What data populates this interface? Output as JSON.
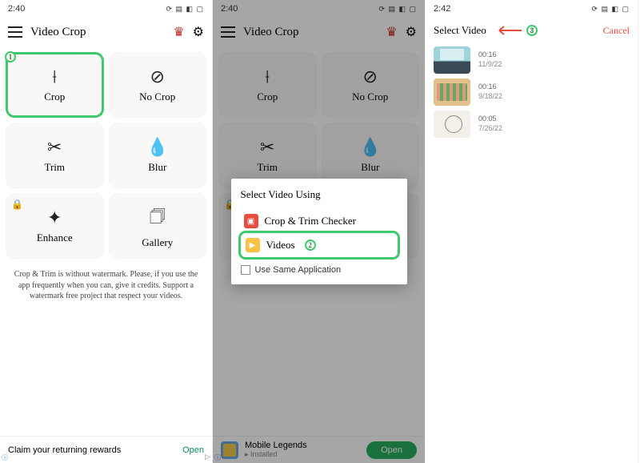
{
  "status": {
    "time1": "2:40",
    "time2": "2:40",
    "time3": "2:42",
    "icons": "⟳ ▤ ◧ ▢"
  },
  "app": {
    "title": "Video Crop",
    "tiles": {
      "crop": "Crop",
      "nocrop": "No Crop",
      "trim": "Trim",
      "blur": "Blur",
      "enhance": "Enhance",
      "gallery": "Gallery"
    },
    "description": "Crop & Trim is without watermark. Please, if you use the app frequently when you can, give it credits. Support a watermark free project that respect your videos."
  },
  "badges": {
    "one": "1",
    "two": "2",
    "three": "3"
  },
  "ads": {
    "row1_text": "Claim your returning rewards",
    "open": "Open",
    "row2_name": "Mobile Legends",
    "row2_sub": "▸ Installed"
  },
  "dialog": {
    "title": "Select Video Using",
    "opt1": "Crop & Trim Checker",
    "opt2": "Videos",
    "checkbox": "Use Same Application"
  },
  "screen3": {
    "title": "Select Video",
    "cancel": "Cancel",
    "items": [
      {
        "dur": "00:16",
        "date": "11/9/22"
      },
      {
        "dur": "00:16",
        "date": "9/18/22"
      },
      {
        "dur": "00:05",
        "date": "7/26/22"
      }
    ]
  }
}
